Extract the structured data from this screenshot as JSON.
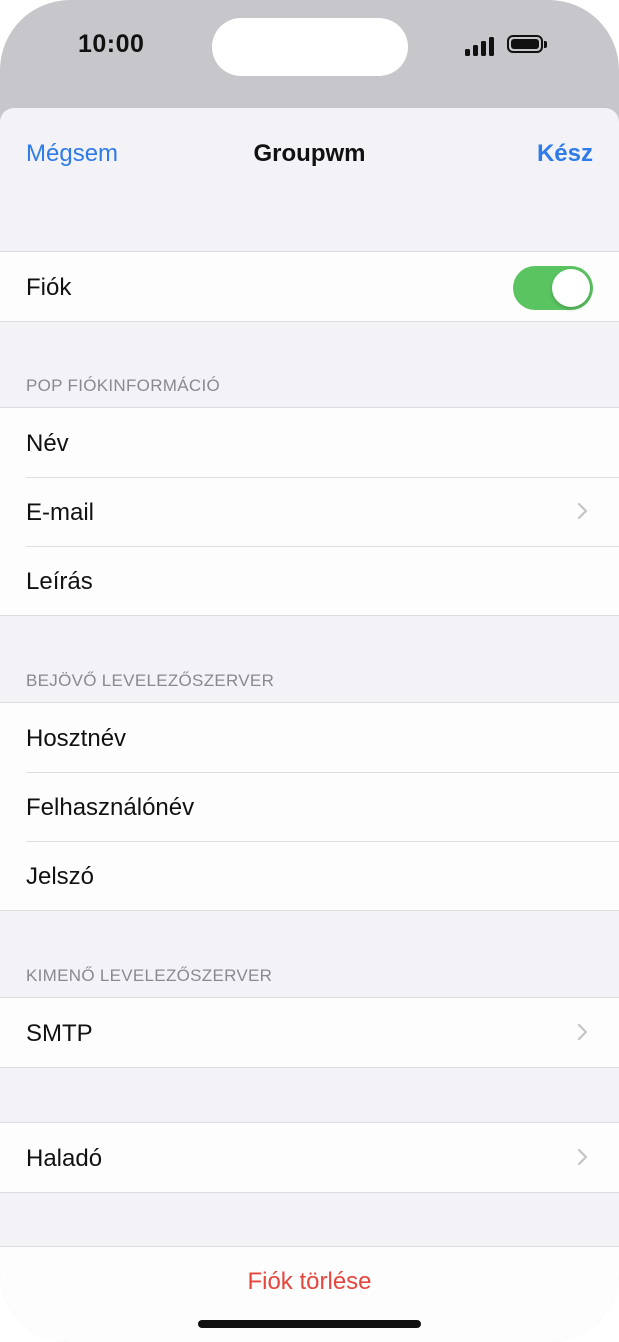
{
  "status_bar": {
    "time": "10:00"
  },
  "nav": {
    "cancel_label": "Mégsem",
    "title": "Groupwm",
    "done_label": "Kész"
  },
  "account_toggle": {
    "label": "Fiók",
    "on": true
  },
  "pop_info": {
    "header": "POP FIÓKINFORMÁCIÓ",
    "rows": [
      {
        "label": "Név"
      },
      {
        "label": "E-mail"
      },
      {
        "label": "Leírás"
      }
    ]
  },
  "incoming": {
    "header": "BEJÖVŐ LEVELEZŐSZERVER",
    "rows": [
      {
        "label": "Hosztnév"
      },
      {
        "label": "Felhasználónév"
      },
      {
        "label": "Jelszó"
      }
    ]
  },
  "outgoing": {
    "header": "KIMENŐ LEVELEZŐSZERVER",
    "smtp_label": "SMTP"
  },
  "advanced": {
    "label": "Haladó"
  },
  "delete": {
    "label": "Fiók törlése"
  },
  "colors": {
    "accent": "#2f7be7",
    "toggle_on": "#5ac461",
    "destructive": "#e5463d"
  },
  "icons": [
    "chevron-right-icon",
    "cellular-signal-icon",
    "battery-icon"
  ]
}
